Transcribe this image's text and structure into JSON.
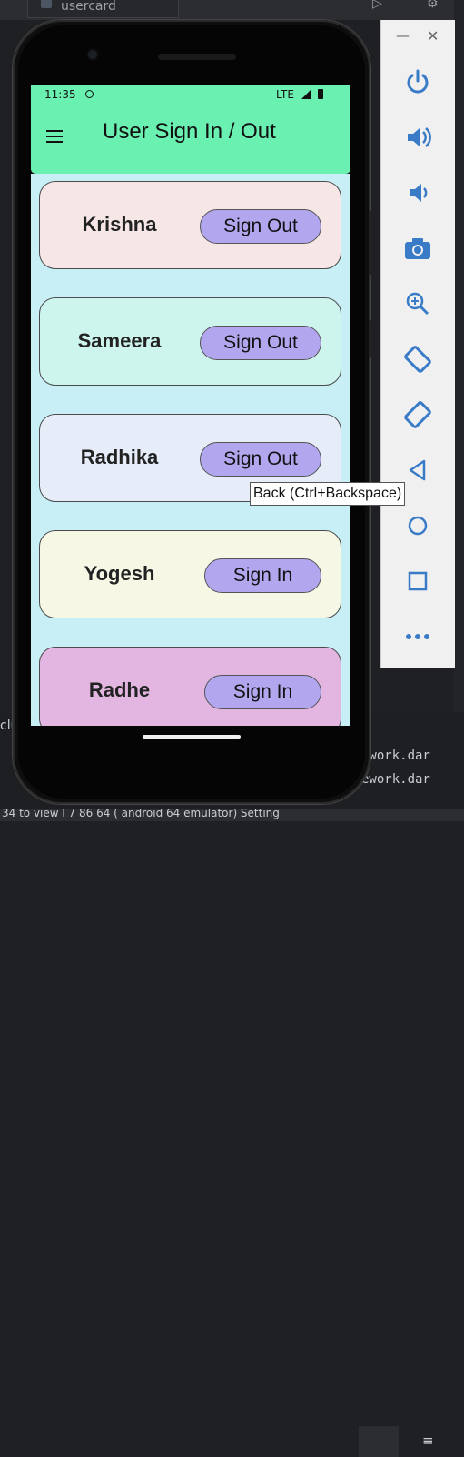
{
  "ide": {
    "tab_label": "usercard",
    "console_lines": [
      "ework.dar",
      "ework.dar"
    ],
    "status_text": "34    to view     l  7     86 64 ( android  64  emulator)      Setting",
    "left_code_text": "clu",
    "wrap_icon": "soft-wrap-icon"
  },
  "device": {
    "time": "11:35",
    "network": "LTE",
    "appbar": {
      "title": "User Sign In / Out",
      "menu_icon": "hamburger-menu-icon",
      "color": "#6af0b0"
    },
    "users": [
      {
        "name": "Krishna",
        "button": "Sign Out",
        "color": "#f6e6e6",
        "signed_in": true
      },
      {
        "name": "Sameera",
        "button": "Sign Out",
        "color": "#cdf5ee",
        "signed_in": true
      },
      {
        "name": "Radhika",
        "button": "Sign Out",
        "color": "#e6ecf8",
        "signed_in": true
      },
      {
        "name": "Yogesh",
        "button": "Sign In",
        "color": "#f7f7e6",
        "signed_in": false
      },
      {
        "name": "Radhe",
        "button": "Sign In",
        "color": "#e3b6e2",
        "signed_in": false
      }
    ],
    "button_color": "#b2a7ef",
    "list_background": "#c8eef6"
  },
  "emulator_toolbar": {
    "minimize": "—",
    "close": "✕",
    "tooltip": "Back (Ctrl+Backspace)",
    "buttons": [
      "power-icon",
      "volume-up-icon",
      "volume-down-icon",
      "camera-icon",
      "zoom-icon",
      "rotate-left-icon",
      "rotate-right-icon",
      "back-icon",
      "home-icon",
      "overview-icon",
      "more-icon"
    ]
  }
}
